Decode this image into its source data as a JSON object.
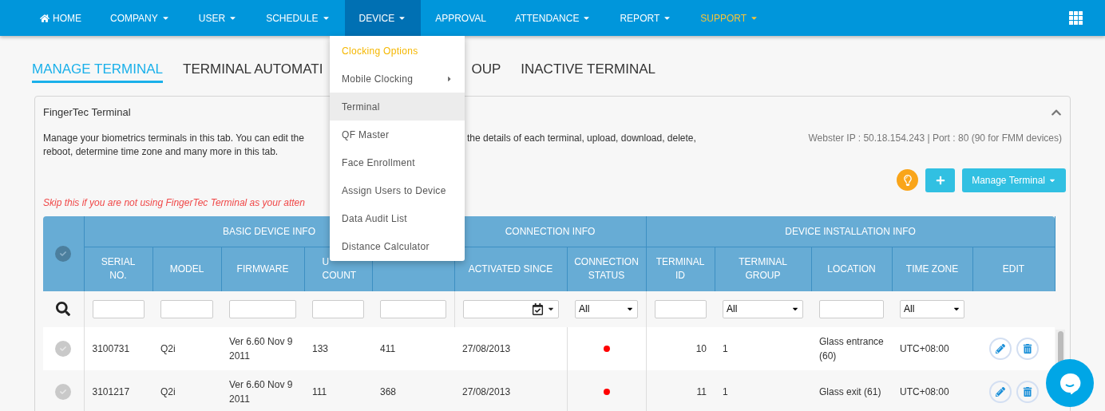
{
  "nav": {
    "items": [
      {
        "label": "HOME",
        "kind": "home",
        "caret": false,
        "selected": false,
        "highlighted": false
      },
      {
        "label": "COMPANY",
        "kind": "menu",
        "caret": true,
        "selected": false,
        "highlighted": false
      },
      {
        "label": "USER",
        "kind": "menu",
        "caret": true,
        "selected": false,
        "highlighted": false
      },
      {
        "label": "SCHEDULE",
        "kind": "menu",
        "caret": true,
        "selected": false,
        "highlighted": false
      },
      {
        "label": "DEVICE",
        "kind": "menu",
        "caret": true,
        "selected": true,
        "highlighted": false
      },
      {
        "label": "APPROVAL",
        "kind": "menu",
        "caret": false,
        "selected": false,
        "highlighted": false
      },
      {
        "label": "ATTENDANCE",
        "kind": "menu",
        "caret": true,
        "selected": false,
        "highlighted": false
      },
      {
        "label": "REPORT",
        "kind": "menu",
        "caret": true,
        "selected": false,
        "highlighted": false
      },
      {
        "label": "SUPPORT",
        "kind": "menu",
        "caret": true,
        "selected": false,
        "highlighted": true
      }
    ]
  },
  "device_menu": [
    {
      "label": "Clocking Options",
      "highlighted": true,
      "submenu": false,
      "selected": false
    },
    {
      "label": "Mobile Clocking",
      "highlighted": false,
      "submenu": true,
      "selected": false
    },
    {
      "label": "Terminal",
      "highlighted": false,
      "submenu": false,
      "selected": true
    },
    {
      "label": "QF Master",
      "highlighted": false,
      "submenu": false,
      "selected": false
    },
    {
      "label": "Face Enrollment",
      "highlighted": false,
      "submenu": false,
      "selected": false
    },
    {
      "label": "Assign Users to Device",
      "highlighted": false,
      "submenu": false,
      "selected": false
    },
    {
      "label": "Data Audit List",
      "highlighted": false,
      "submenu": false,
      "selected": false
    },
    {
      "label": "Distance Calculator",
      "highlighted": false,
      "submenu": false,
      "selected": false
    }
  ],
  "tabs": [
    {
      "label": "MANAGE TERMINAL",
      "selected": true
    },
    {
      "label": "TERMINAL AUTOMATI",
      "selected": false
    },
    {
      "label": "OUP",
      "selected": false
    },
    {
      "label": "INACTIVE TERMINAL",
      "selected": false
    }
  ],
  "card": {
    "title": "FingerTec Terminal",
    "expanded": true,
    "description_parts": [
      "Manage your biometrics terminals in this tab. You can edit the",
      "the details of each terminal, upload, download, delete,",
      "reboot, determine time zone and many more in this tab."
    ],
    "server_info": "Webster IP : 50.18.154.243 | Port : 80 (90 for FMM devices)",
    "action_button": "Manage Terminal",
    "warning": "Skip this if you are not using FingerTec Terminal as your atten"
  },
  "table": {
    "select_all_checked": false,
    "groups": [
      {
        "label": "BASIC DEVICE INFO"
      },
      {
        "label": "CONNECTION INFO"
      },
      {
        "label": "DEVICE INSTALLATION INFO"
      }
    ],
    "columns": [
      {
        "label": "SERIAL\nNO."
      },
      {
        "label": "MODEL"
      },
      {
        "label": "FIRMWARE"
      },
      {
        "label": "U\nCOUNT"
      },
      {},
      {
        "label": "ACTIVATED SINCE"
      },
      {
        "label": "CONNECTION\nSTATUS"
      },
      {
        "label": "TERMINAL\nID"
      },
      {
        "label": "TERMINAL\nGROUP"
      },
      {
        "label": "LOCATION"
      },
      {
        "label": "TIME ZONE"
      },
      {
        "label": "EDIT"
      }
    ],
    "filters": [
      {
        "kind": "search"
      },
      {
        "kind": "text"
      },
      {
        "kind": "text"
      },
      {
        "kind": "text"
      },
      {
        "kind": "text"
      },
      {
        "kind": "text"
      },
      {
        "kind": "date"
      },
      {
        "kind": "select",
        "value": "All"
      },
      {
        "kind": "text"
      },
      {
        "kind": "select",
        "value": "All"
      },
      {
        "kind": "text"
      },
      {
        "kind": "select",
        "value": "All"
      },
      {
        "kind": "none"
      }
    ],
    "rows": [
      {
        "checked": false,
        "serial": "3100731",
        "model": "Q2i",
        "firmware": "Ver 6.60 Nov 9 2011",
        "user_count": "133",
        "fingerprint": "411",
        "activated": "27/08/2013",
        "status": {
          "color": "#ff0000"
        },
        "terminal_id": "10",
        "group": "1",
        "location": "Glass entrance (60)",
        "time_zone": "UTC+08:00"
      },
      {
        "checked": false,
        "serial": "3101217",
        "model": "Q2i",
        "firmware": "Ver 6.60 Nov 9 2011",
        "user_count": "111",
        "fingerprint": "368",
        "activated": "27/08/2013",
        "status": {
          "color": "#ff0000"
        },
        "terminal_id": "11",
        "group": "1",
        "location": "Glass exit (61)",
        "time_zone": "UTC+08:00"
      }
    ]
  }
}
